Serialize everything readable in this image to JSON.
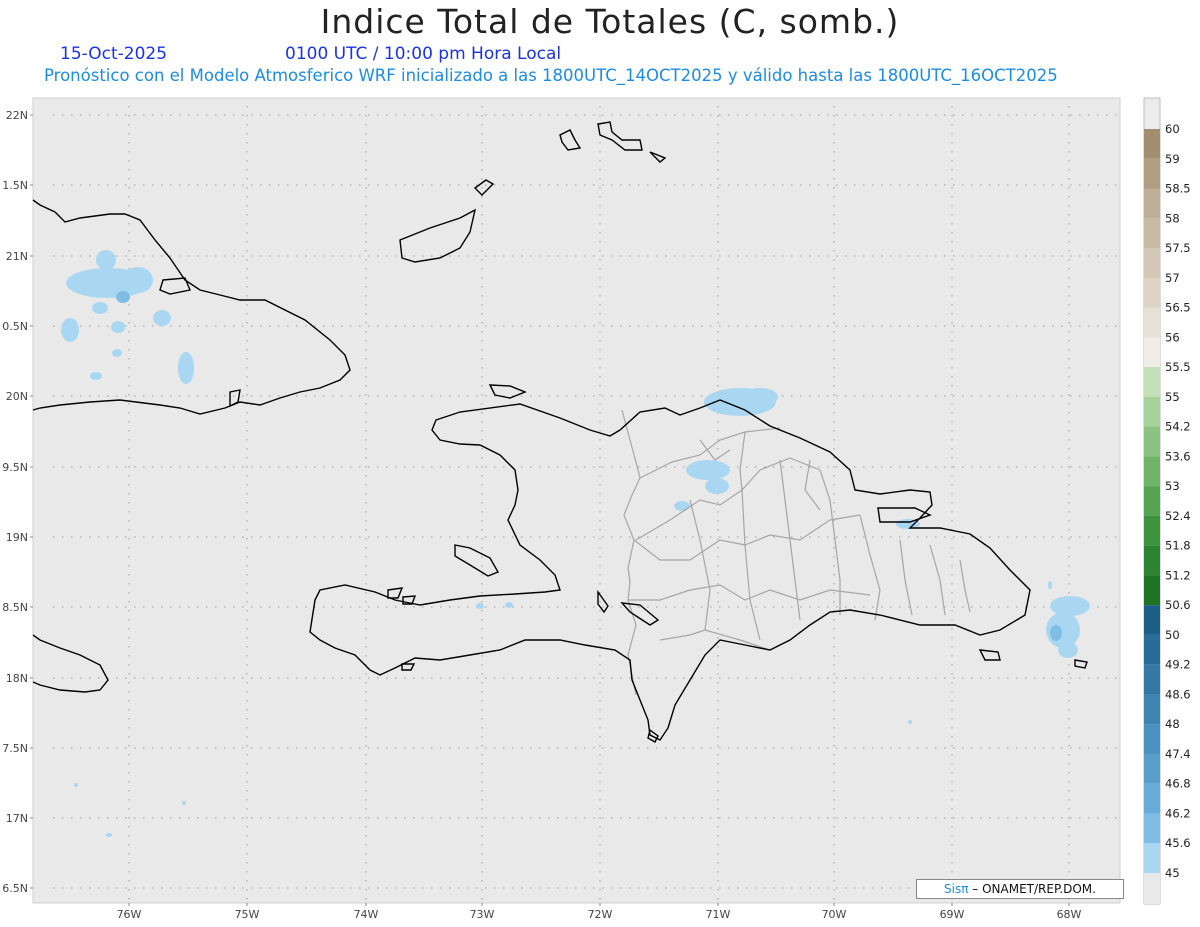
{
  "header": {
    "title": "Indice Total de Totales (C, somb.)",
    "date": "15-Oct-2025",
    "time": "0100 UTC / 10:00 pm Hora Local",
    "forecast": "Pronóstico con el Modelo Atmosferico WRF inicializado a las 1800UTC_14OCT2025 y válido hasta las  1800UTC_16OCT2025"
  },
  "map": {
    "lat_labels": [
      "22N",
      "1.5N",
      "21N",
      "0.5N",
      "20N",
      "9.5N",
      "19N",
      "8.5N",
      "18N",
      "7.5N",
      "17N",
      "6.5N"
    ],
    "lon_labels": [
      "76W",
      "75W",
      "74W",
      "73W",
      "72W",
      "71W",
      "70W",
      "69W",
      "68W"
    ],
    "land_color": "#e9e9e9",
    "coast_color": "#000000",
    "border_color": "#a6a6a6",
    "grid": true
  },
  "colorbar": {
    "labels": [
      "60",
      "59",
      "58.5",
      "58",
      "57.5",
      "57",
      "56.5",
      "56",
      "55.5",
      "55",
      "54.2",
      "53.6",
      "53",
      "52.4",
      "51.8",
      "51.2",
      "50.6",
      "50",
      "49.2",
      "48.6",
      "48",
      "47.4",
      "46.8",
      "46.2",
      "45.6",
      "45"
    ],
    "colors": [
      "#8c7a58",
      "#a18f70",
      "#b09e82",
      "#bdae95",
      "#c8baa5",
      "#d3c8b6",
      "#ddd4c6",
      "#e6e0d6",
      "#f0ece6",
      "#c4e0b8",
      "#a8d29c",
      "#8cc382",
      "#70b468",
      "#56a451",
      "#3e943e",
      "#2c8430",
      "#1f7324",
      "#1d5f87",
      "#2a6c98",
      "#3478a5",
      "#3d84b2",
      "#4891c0",
      "#579ecd",
      "#68acd9",
      "#7fbde4",
      "#a9d7f2"
    ]
  },
  "credit": {
    "brand": "Sisπ",
    "text": " – ONAMET/REP.DOM."
  }
}
